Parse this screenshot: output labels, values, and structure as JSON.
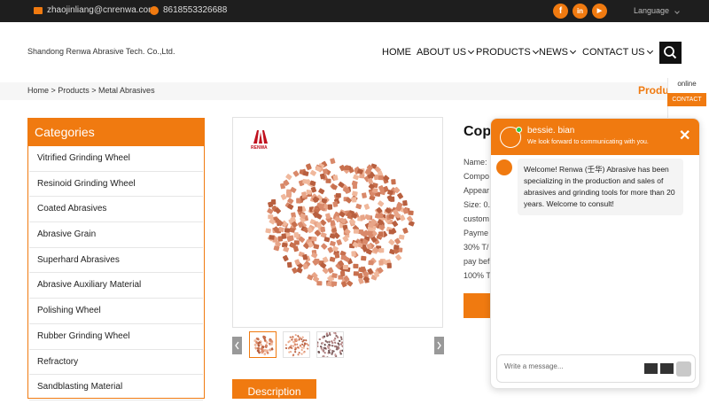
{
  "topbar": {
    "email": "zhaojinliang@cnrenwa.com",
    "phone": "8618553326688",
    "social_icons": [
      "facebook-icon",
      "linkedin-icon",
      "youtube-icon"
    ],
    "facebook_glyph": "f",
    "linkedin_glyph": "in",
    "youtube_glyph": "▶",
    "language": "Language"
  },
  "header": {
    "company": "Shandong Renwa Abrasive Tech. Co.,Ltd.",
    "nav": {
      "home": "HOME",
      "about": "ABOUT US",
      "products": "PRODUCTS",
      "news": "NEWS",
      "contact": "CONTACT US"
    }
  },
  "breadcrumb": "Home > Products > Metal Abrasives",
  "products_heading": "Produc",
  "categories": {
    "title": "Categories",
    "items": [
      "Vitrified Grinding Wheel",
      "Resinoid Grinding Wheel",
      "Coated Abrasives",
      "Abrasive Grain",
      "Superhard Abrasives",
      "Abrasive Auxiliary Material",
      "Polishing Wheel",
      "Rubber Grinding Wheel",
      "Refractory",
      "Sandblasting Material"
    ]
  },
  "gallery": {
    "logo_text": "RENWA"
  },
  "description_tab": "Description",
  "product": {
    "title": "Cop",
    "specs": [
      "Name:",
      "Compo",
      "Appear",
      "Size: 0.",
      "custom",
      "Payme",
      "30% T/",
      "pay bef",
      "100% T"
    ]
  },
  "side": {
    "online": "online",
    "contact": "CONTACT"
  },
  "chat": {
    "agent_name": "bessie. bian",
    "agent_subtitle": "We look forward to communicating with you.",
    "close": "✕",
    "welcome": "Welcome! Renwa (壬华) Abrasive has been specializing in the production and sales of abrasives and grinding tools for more than 20 years. Welcome to consult!",
    "placeholder": "Write a message..."
  },
  "colors": {
    "accent": "#f07a10",
    "topbar": "#1e1e1e",
    "online_dot": "#2ecc40"
  }
}
